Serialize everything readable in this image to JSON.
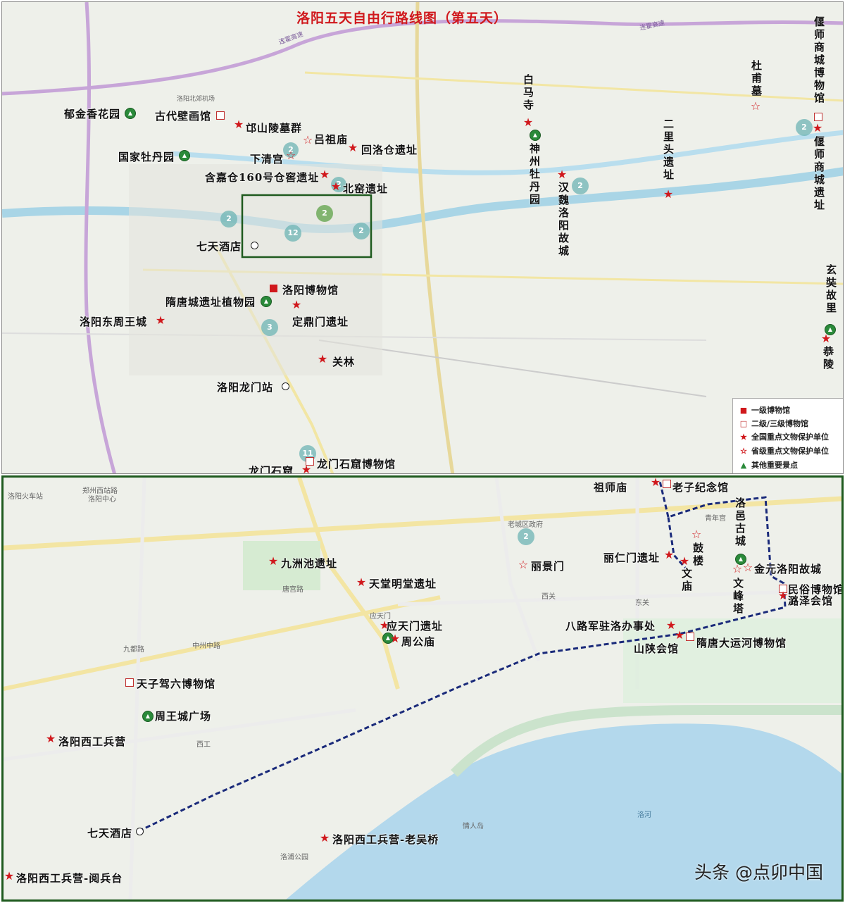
{
  "top": {
    "title": "洛阳五天自由行路线图（第五天）",
    "labels": {
      "yujinxiang": "郁金香花园",
      "gudai_bihua": "古代壁画馆",
      "mangshan": "邙山陵墓群",
      "lvzumiao": "吕祖庙",
      "huiluocang": "回洛仓遗址",
      "guose_mudan": "国家牡丹园",
      "xiaqinggong": "下清宫",
      "hanjiacang": "含嘉仓160号仓窖遗址",
      "beiyao": "北窑遗址",
      "qitian": "七天酒店",
      "luoyang_bowuguan": "洛阳博物馆",
      "suitang_zhiwuyuan": "隋唐城遗址植物园",
      "dingdingmen": "定鼎门遗址",
      "dongzhou": "洛阳东周王城",
      "guanlin": "关林",
      "longmen_zhan": "洛阳龙门站",
      "longmen_shiku_bwg": "龙门石窟博物馆",
      "longmen_shiku": "龙门石窟",
      "baimasi": "白马寺",
      "shenzhou": "神州牡丹园",
      "hanwei": "汉魏洛阳故城",
      "erlitou": "二里头遗址",
      "dufu": "杜甫墓",
      "yanshi_bwg": "偃师商城博物馆",
      "yanshi_yizhi": "偃师商城遗址",
      "xuanzang": "玄奘故里",
      "gongling": "恭陵"
    },
    "legend": [
      {
        "symbol": "filled-square",
        "label": "一级博物馆"
      },
      {
        "symbol": "hollow-square",
        "label": "二级/三级博物馆"
      },
      {
        "symbol": "filled-star",
        "label": "全国重点文物保护单位"
      },
      {
        "symbol": "hollow-star",
        "label": "省级重点文物保护单位"
      },
      {
        "symbol": "green-triangle",
        "label": "其他重要景点"
      }
    ],
    "clusters": [
      "2",
      "2",
      "2",
      "2",
      "12",
      "2",
      "3",
      "11",
      "2",
      "2"
    ],
    "roads": {
      "lianhuo_1": "连霍高速",
      "lianhuo_2": "连霍高速",
      "guoxiang": "洛阳北郊机场"
    }
  },
  "bottom": {
    "labels": {
      "zushimiao": "祖师庙",
      "laozi": "老子纪念馆",
      "luoyi_gucheng": "洛邑古城",
      "jiuzhouchi": "九洲池遗址",
      "tiantang": "天堂明堂遗址",
      "lijingmen": "丽景门",
      "lirenmen": "丽仁门遗址",
      "gulou": "鼓楼",
      "wenmiao": "文庙",
      "wenfengta": "文峰塔",
      "jinyuan": "金元洛阳故城",
      "minsu": "民俗博物馆",
      "luze": "潞泽会馆",
      "yingtianmen": "应天门遗址",
      "zhougongmiao": "周公庙",
      "balujun": "八路军驻洛办事处",
      "shanshan": "山陕会馆",
      "suitang_yunhe": "隋唐大运河博物馆",
      "tianzi": "天子驾六博物馆",
      "zhouwangcheng": "周王城广场",
      "xigong": "洛阳西工兵营",
      "qitian": "七天酒店",
      "laoqiao": "洛阳西工兵营-老吴桥",
      "yuebingtai": "洛阳西工兵营-阅兵台"
    },
    "streets": [
      "洛阳火车站",
      "郑州西站路",
      "洛阳中心",
      "唐宫路",
      "中州中路",
      "九都路",
      "西工",
      "老城区政府",
      "青年宫",
      "丽景门",
      "西关",
      "应天门",
      "东关",
      "洛浦公园",
      "情人岛",
      "洛河"
    ],
    "cluster": "2"
  },
  "watermark": "头条 @点卯中国"
}
